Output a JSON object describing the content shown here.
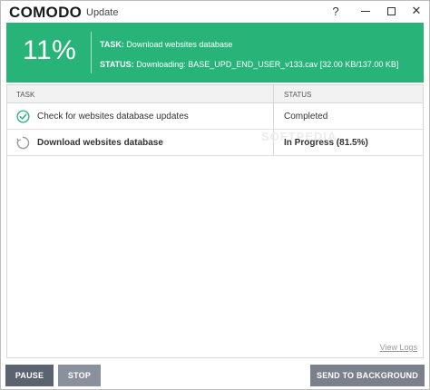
{
  "window": {
    "logo": "COMODO",
    "title": "Update",
    "controls": {
      "help": "?",
      "min_icon": "minimize-icon",
      "max_icon": "maximize-icon",
      "close": "✕"
    }
  },
  "banner": {
    "percent": "11%",
    "task_label": "TASK:",
    "task_value": "Download websites database",
    "status_label": "STATUS:",
    "status_value": "Downloading: BASE_UPD_END_USER_v133.cav [32.00 KB/137.00 KB]",
    "progress": 0.11,
    "color": "#28b478"
  },
  "table": {
    "columns": [
      "TASK",
      "STATUS"
    ],
    "rows": [
      {
        "icon": "check-circle-icon",
        "task": "Check for websites database updates",
        "status": "Completed"
      },
      {
        "icon": "spinner-icon",
        "task": "Download websites database",
        "status": "In Progress (81.5%)"
      }
    ],
    "watermark": "SOFTPEDIA",
    "view_logs": "View Logs"
  },
  "buttons": {
    "pause": "PAUSE",
    "stop": "STOP",
    "send_to_background": "SEND TO BACKGROUND"
  }
}
